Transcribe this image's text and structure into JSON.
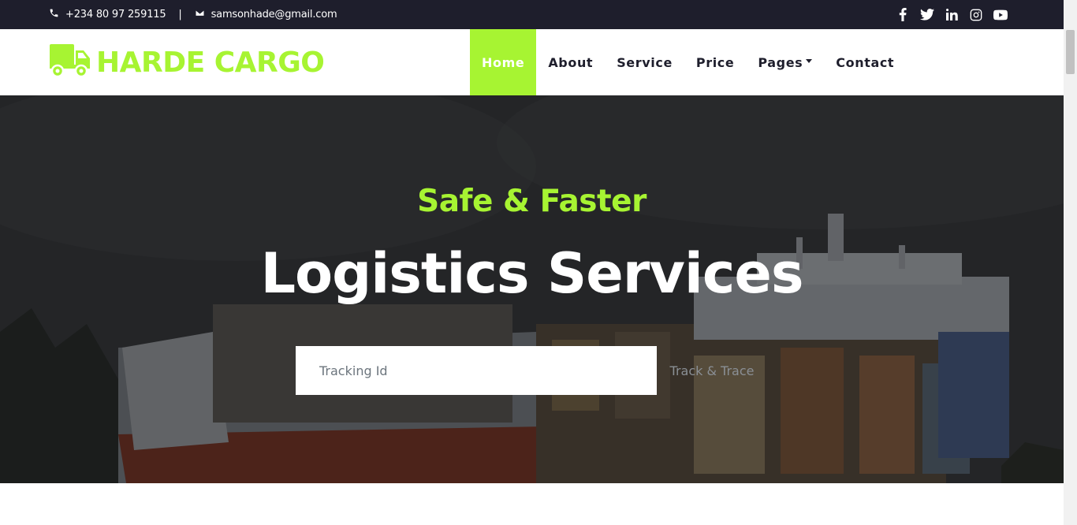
{
  "topbar": {
    "phone": "+234 80 97 259115",
    "separator": "|",
    "email": "samsonhade@gmail.com",
    "social": [
      "facebook-icon",
      "twitter-icon",
      "linkedin-icon",
      "instagram-icon",
      "youtube-icon"
    ]
  },
  "brand": {
    "name": "HARDE CARGO",
    "icon": "truck-icon",
    "color": "#a7f432"
  },
  "nav": {
    "items": [
      {
        "label": "Home",
        "active": true
      },
      {
        "label": "About",
        "active": false
      },
      {
        "label": "Service",
        "active": false
      },
      {
        "label": "Price",
        "active": false
      },
      {
        "label": "Pages",
        "active": false
      },
      {
        "label": "Contact",
        "active": false
      }
    ]
  },
  "hero": {
    "subtitle": "Safe & Faster",
    "title": "Logistics Services",
    "search_placeholder": "Tracking Id",
    "button_label": "Track & Trace"
  },
  "colors": {
    "accent": "#a7f432",
    "dark": "#1e1e2c"
  }
}
